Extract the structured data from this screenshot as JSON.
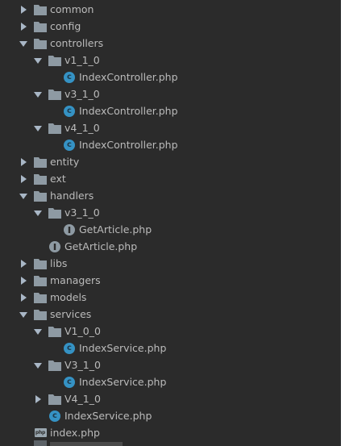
{
  "project_tree": {
    "items": [
      {
        "label": "common",
        "type": "folder",
        "expanded": false
      },
      {
        "label": "config",
        "type": "folder",
        "expanded": false
      },
      {
        "label": "controllers",
        "type": "folder",
        "expanded": true
      },
      {
        "label": "v1_1_0",
        "type": "folder",
        "expanded": true
      },
      {
        "label": "IndexController.php",
        "type": "class"
      },
      {
        "label": "v3_1_0",
        "type": "folder",
        "expanded": true
      },
      {
        "label": "IndexController.php",
        "type": "class"
      },
      {
        "label": "v4_1_0",
        "type": "folder",
        "expanded": true
      },
      {
        "label": "IndexController.php",
        "type": "class"
      },
      {
        "label": "entity",
        "type": "folder",
        "expanded": false
      },
      {
        "label": "ext",
        "type": "folder",
        "expanded": false
      },
      {
        "label": "handlers",
        "type": "folder",
        "expanded": true
      },
      {
        "label": "v3_1_0",
        "type": "folder",
        "expanded": true
      },
      {
        "label": "GetArticle.php",
        "type": "interface"
      },
      {
        "label": "GetArticle.php",
        "type": "interface"
      },
      {
        "label": "libs",
        "type": "folder",
        "expanded": false
      },
      {
        "label": "managers",
        "type": "folder",
        "expanded": false
      },
      {
        "label": "models",
        "type": "folder",
        "expanded": false
      },
      {
        "label": "services",
        "type": "folder",
        "expanded": true
      },
      {
        "label": "V1_0_0",
        "type": "folder",
        "expanded": true
      },
      {
        "label": "IndexService.php",
        "type": "class"
      },
      {
        "label": "V3_1_0",
        "type": "folder",
        "expanded": true
      },
      {
        "label": "IndexService.php",
        "type": "class"
      },
      {
        "label": "V4_1_0",
        "type": "folder",
        "expanded": false
      },
      {
        "label": "IndexService.php",
        "type": "class"
      },
      {
        "label": "index.php",
        "type": "php"
      }
    ],
    "colors": {
      "background": "#2b2b2b",
      "text": "#bbbbbb",
      "folder": "#8e9aa3",
      "arrow": "#a9b7c6",
      "class_icon": "#3592c4",
      "php_icon": "#9aa7b0"
    }
  }
}
